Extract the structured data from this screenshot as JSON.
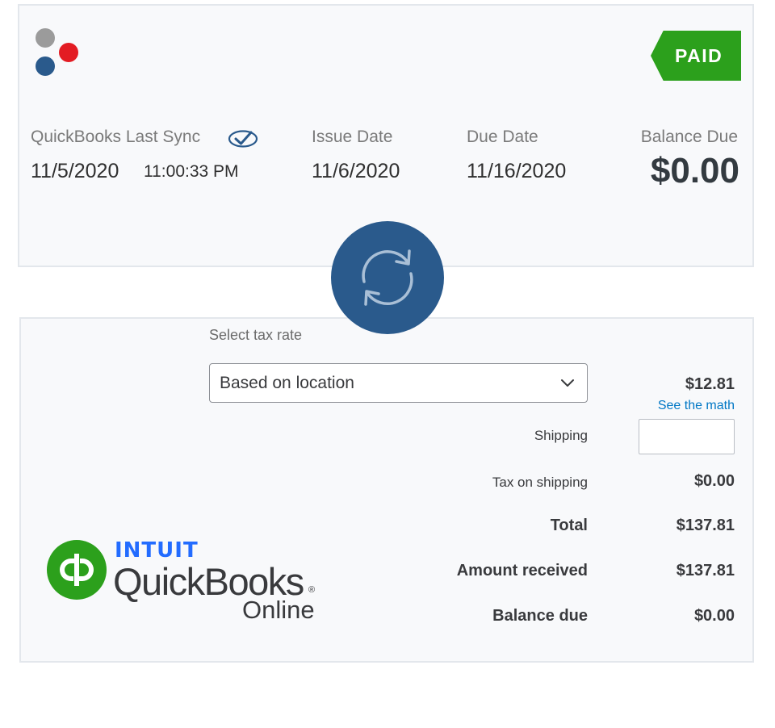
{
  "invoice": {
    "status_badge": "PAID",
    "sync_label": "QuickBooks Last Sync",
    "sync_date": "11/5/2020",
    "sync_time": "11:00:33 PM",
    "issue_date_label": "Issue Date",
    "issue_date": "11/6/2020",
    "due_date_label": "Due Date",
    "due_date": "11/16/2020",
    "balance_due_label": "Balance Due",
    "balance_due": "$0.00"
  },
  "icons": {
    "logo": "three-dots-logo-icon",
    "sync_check": "check-circle-icon",
    "sync": "sync-arrows-icon",
    "dropdown": "chevron-down-icon",
    "quickbooks": "quickbooks-logo-icon"
  },
  "tax": {
    "select_label": "Select tax rate",
    "selected_value": "Based on location"
  },
  "totals": {
    "tax_amount": "$12.81",
    "see_the_math": "See the math",
    "shipping_label": "Shipping",
    "shipping_value": "",
    "tax_on_shipping_label": "Tax on shipping",
    "tax_on_shipping_value": "$0.00",
    "total_label": "Total",
    "total_value": "$137.81",
    "amount_received_label": "Amount received",
    "amount_received_value": "$137.81",
    "balance_due_label": "Balance due",
    "balance_due_value": "$0.00"
  },
  "branding": {
    "intuit": "INTUIT",
    "quickbooks": "QuickBooks",
    "registered": "®",
    "online": "Online"
  },
  "colors": {
    "paid_green": "#2ca01c",
    "sync_blue": "#2a5a8c",
    "link_blue": "#0077c5",
    "intuit_blue": "#236cff",
    "dot_gray": "#9b9b9b",
    "dot_red": "#e31c23",
    "dot_blue": "#2a5a8c"
  }
}
